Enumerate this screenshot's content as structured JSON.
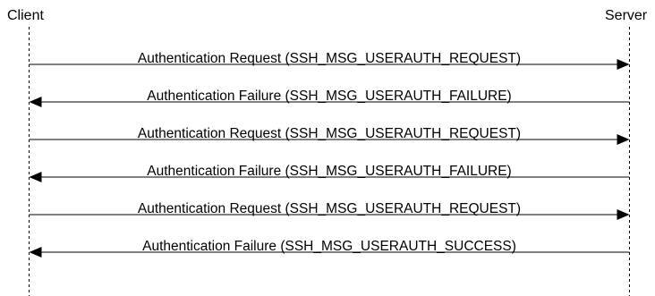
{
  "participants": {
    "client": "Client",
    "server": "Server"
  },
  "messages": [
    {
      "from": "client",
      "to": "server",
      "label": "Authentication Request (SSH_MSG_USERAUTH_REQUEST)"
    },
    {
      "from": "server",
      "to": "client",
      "label": "Authentication Failure (SSH_MSG_USERAUTH_FAILURE)"
    },
    {
      "from": "client",
      "to": "server",
      "label": "Authentication Request (SSH_MSG_USERAUTH_REQUEST)"
    },
    {
      "from": "server",
      "to": "client",
      "label": "Authentication Failure (SSH_MSG_USERAUTH_FAILURE)"
    },
    {
      "from": "client",
      "to": "server",
      "label": "Authentication Request (SSH_MSG_USERAUTH_REQUEST)"
    },
    {
      "from": "server",
      "to": "client",
      "label": "Authentication Failure (SSH_MSG_USERAUTH_SUCCESS)"
    }
  ],
  "colors": {
    "line": "#000000",
    "background": "#ffffff"
  }
}
